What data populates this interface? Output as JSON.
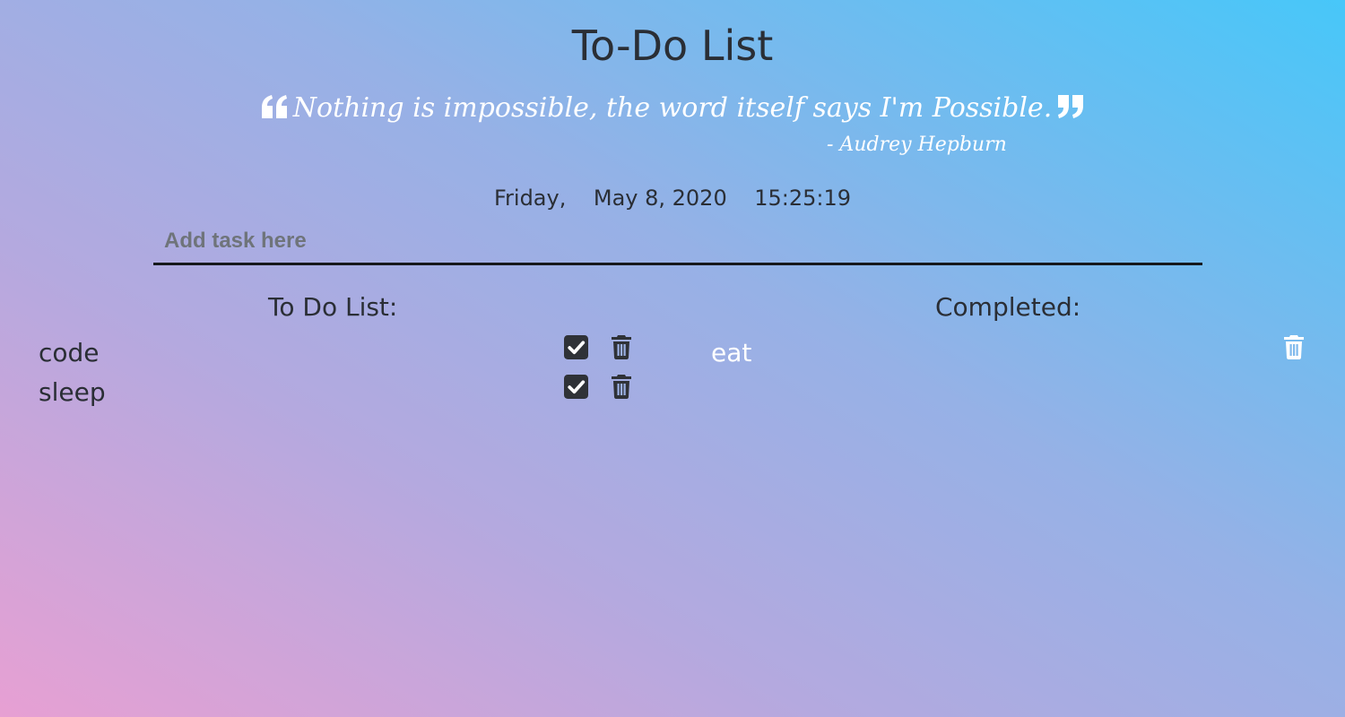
{
  "page": {
    "title": "To-Do List"
  },
  "quote": {
    "open_icon": "quote-left-icon",
    "text": "Nothing is impossible, the word itself says I'm Possible.",
    "close_icon": "quote-right-icon",
    "author": "- Audrey Hepburn"
  },
  "datetime": {
    "day": "Friday,",
    "date": "May 8, 2020",
    "time": "15:25:19"
  },
  "task_input": {
    "placeholder": "Add task here",
    "value": ""
  },
  "todo": {
    "heading": "To Do List:",
    "items": [
      {
        "label": "code",
        "check_icon": "check-square-icon",
        "delete_icon": "trash-icon"
      },
      {
        "label": "sleep",
        "check_icon": "check-square-icon",
        "delete_icon": "trash-icon"
      }
    ]
  },
  "completed": {
    "heading": "Completed:",
    "items": [
      {
        "label": "eat",
        "delete_icon": "trash-icon"
      }
    ]
  },
  "colors": {
    "text": "#2a2e35",
    "quote_text": "#ffffff",
    "completed_text": "#ffffff",
    "icon_dark": "#2f3237",
    "icon_light": "#ffffff",
    "underline": "#16181b",
    "gradient": [
      "#e7a0d3",
      "#b4a9df",
      "#96b1e6",
      "#47c7f9"
    ]
  }
}
